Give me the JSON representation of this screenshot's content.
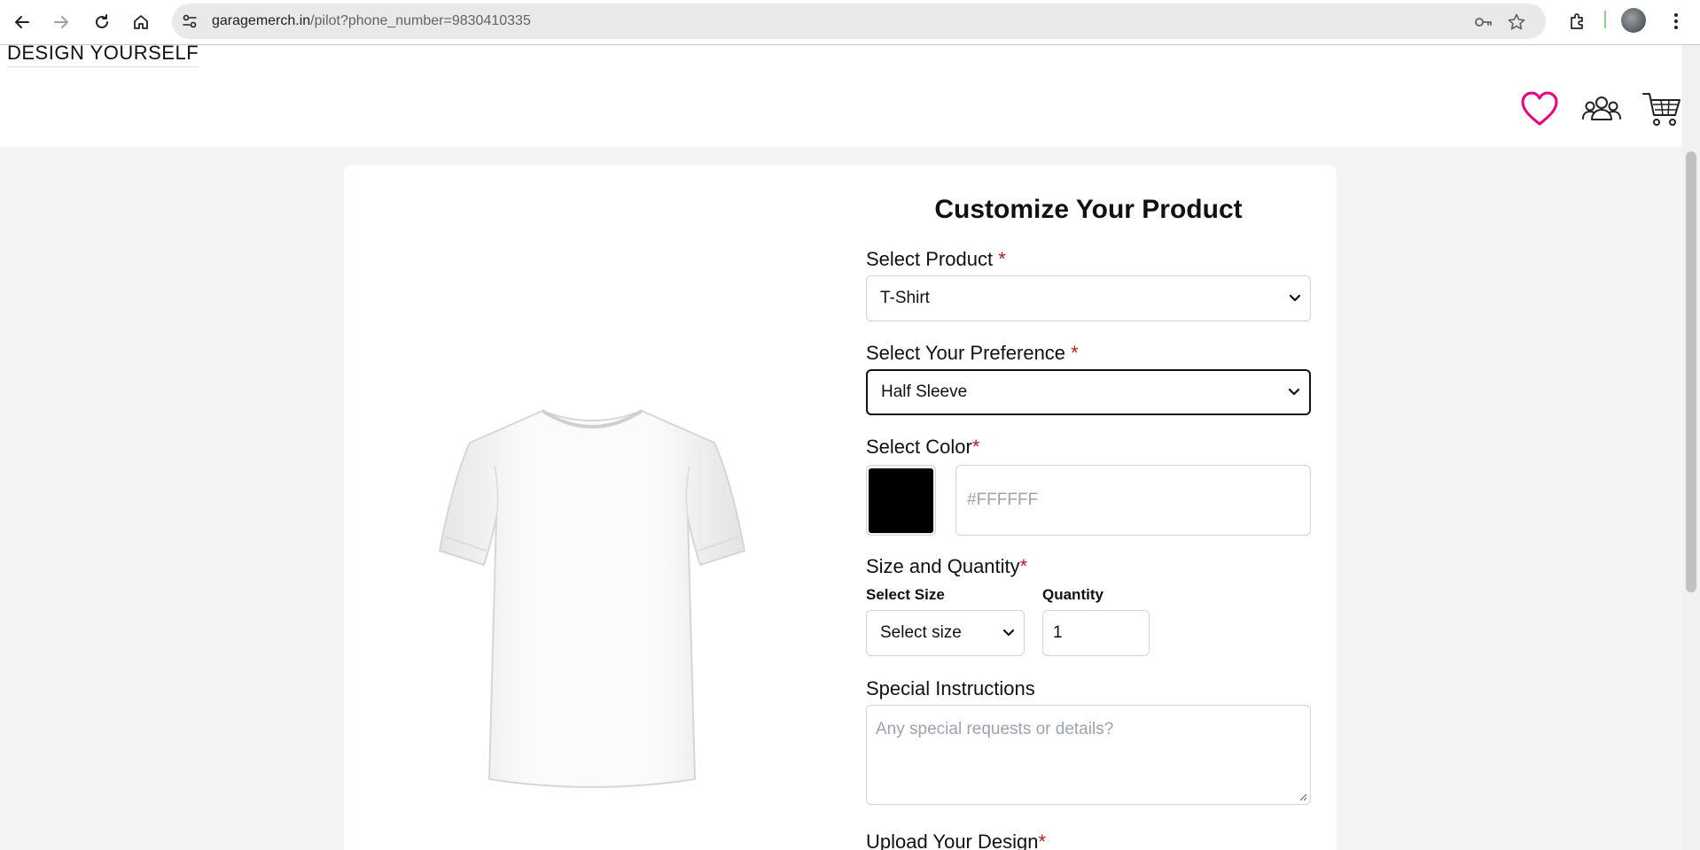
{
  "browser": {
    "url_host": "garagemerch.in",
    "url_path": "/pilot?phone_number=9830410335"
  },
  "header": {
    "brand": "DESIGN YOURSELF"
  },
  "form": {
    "title": "Customize Your Product",
    "product": {
      "label": "Select Product",
      "required_mark": "*",
      "value": "T-Shirt"
    },
    "preference": {
      "label": "Select Your Preference",
      "required_mark": "*",
      "value": "Half Sleeve"
    },
    "color": {
      "label": "Select Color",
      "required_mark": "*",
      "swatch_color": "#000000",
      "placeholder": "#FFFFFF"
    },
    "size_quantity": {
      "label": "Size and Quantity",
      "required_mark": "*",
      "size_label": "Select Size",
      "size_value": "Select size",
      "quantity_label": "Quantity",
      "quantity_value": "1"
    },
    "instructions": {
      "label": "Special Instructions",
      "placeholder": "Any special requests or details?"
    },
    "upload": {
      "label": "Upload Your Design",
      "required_mark": "*"
    }
  },
  "colors": {
    "heart": "#e6007e",
    "required": "#b91c1c",
    "page_bg": "#f3f4f6"
  },
  "icons": {
    "back": "arrow-left-icon",
    "forward": "arrow-right-icon",
    "reload": "reload-icon",
    "home": "home-icon",
    "wishlist": "heart-icon",
    "community": "users-icon",
    "cart": "cart-icon"
  }
}
